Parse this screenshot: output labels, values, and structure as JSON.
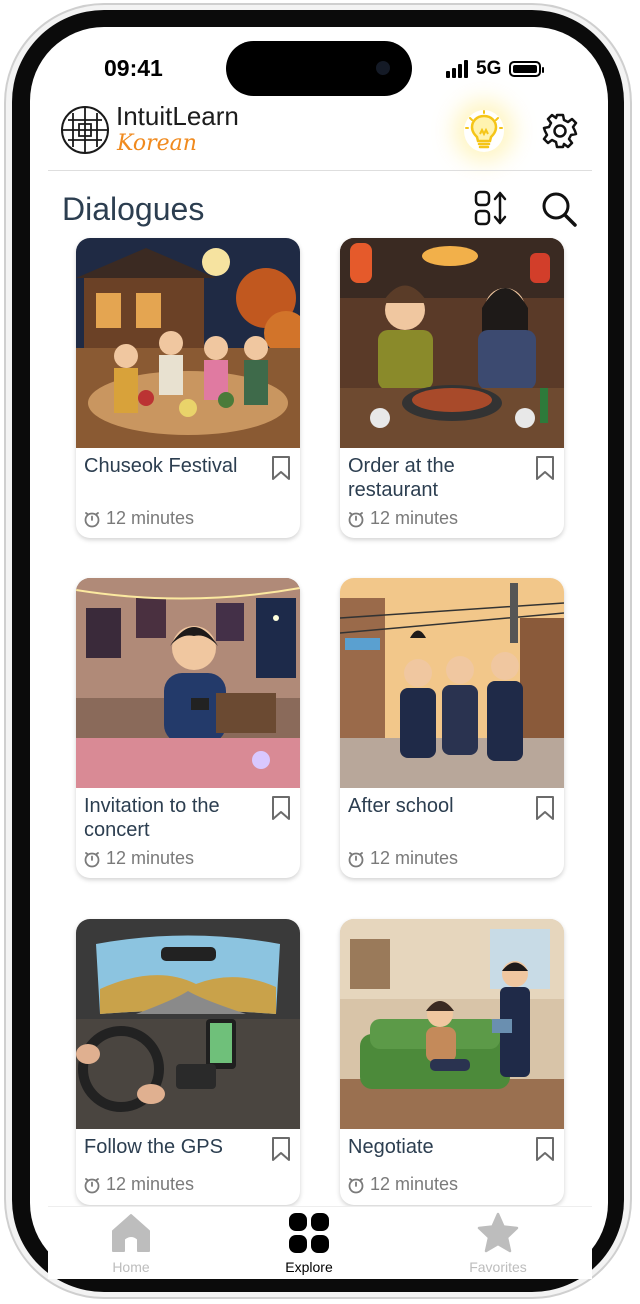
{
  "status": {
    "time": "09:41",
    "network": "5G"
  },
  "header": {
    "brand": "IntuitLearn",
    "language": "Korean"
  },
  "page": {
    "title": "Dialogues"
  },
  "cards": [
    {
      "title": "Chuseok Festival",
      "duration": "12 minutes"
    },
    {
      "title": "Order at the restaurant",
      "duration": "12 minutes"
    },
    {
      "title": "Invitation to the concert",
      "duration": "12 minutes"
    },
    {
      "title": "After school",
      "duration": "12 minutes"
    },
    {
      "title": "Follow the GPS",
      "duration": "12 minutes"
    },
    {
      "title": "Negotiate",
      "duration": "12 minutes"
    }
  ],
  "tabs": [
    {
      "label": "Home",
      "active": false
    },
    {
      "label": "Explore",
      "active": true
    },
    {
      "label": "Favorites",
      "active": false
    }
  ],
  "colors": {
    "accent_orange": "#f08a1e",
    "title_text": "#2c3e50",
    "bulb": "#f5c518"
  }
}
